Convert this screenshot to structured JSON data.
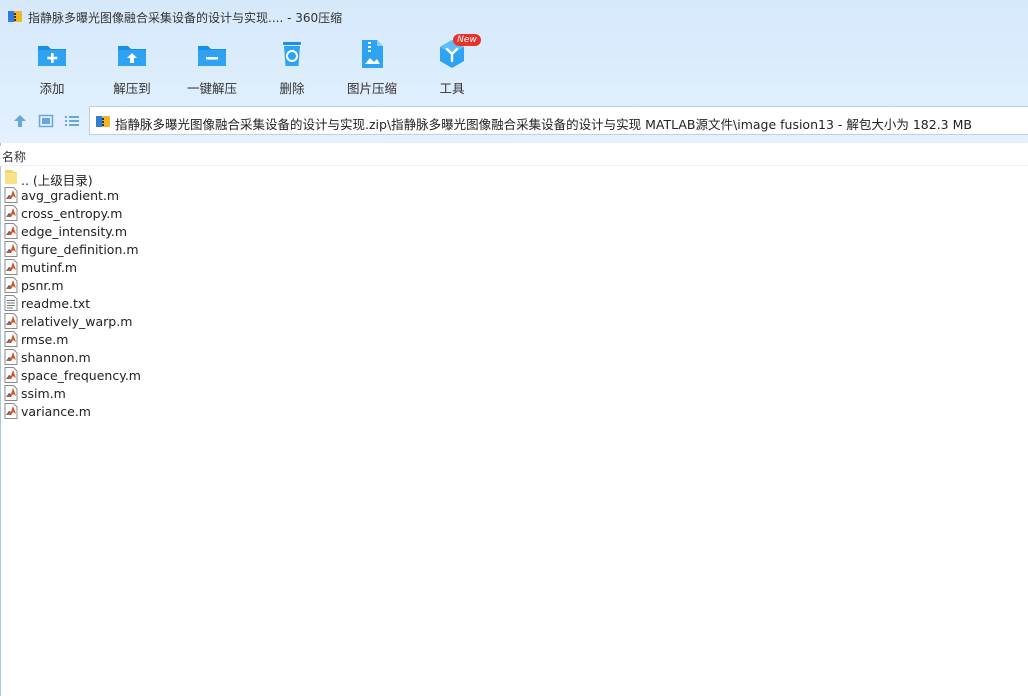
{
  "window": {
    "title": "指静脉多曝光图像融合采集设备的设计与实现.... - 360压缩"
  },
  "toolbar": {
    "buttons": [
      {
        "label": "添加",
        "icon": "add-icon"
      },
      {
        "label": "解压到",
        "icon": "extract-to-icon"
      },
      {
        "label": "一键解压",
        "icon": "one-click-extract-icon"
      },
      {
        "label": "删除",
        "icon": "delete-icon"
      },
      {
        "label": "图片压缩",
        "icon": "image-compress-icon"
      },
      {
        "label": "工具",
        "icon": "tools-icon"
      }
    ],
    "new_badge": "New"
  },
  "navigation": {
    "path": "指静脉多曝光图像融合采集设备的设计与实现.zip\\指静脉多曝光图像融合采集设备的设计与实现 MATLAB源文件\\image fusion13 - 解包大小为 182.3 MB"
  },
  "list": {
    "column_name": "名称",
    "parent_label": ".. (上级目录)",
    "files": [
      {
        "name": "avg_gradient.m",
        "type": "matlab"
      },
      {
        "name": "cross_entropy.m",
        "type": "matlab"
      },
      {
        "name": "edge_intensity.m",
        "type": "matlab"
      },
      {
        "name": "figure_definition.m",
        "type": "matlab"
      },
      {
        "name": "mutinf.m",
        "type": "matlab"
      },
      {
        "name": "psnr.m",
        "type": "matlab"
      },
      {
        "name": "readme.txt",
        "type": "text"
      },
      {
        "name": "relatively_warp.m",
        "type": "matlab"
      },
      {
        "name": "rmse.m",
        "type": "matlab"
      },
      {
        "name": "shannon.m",
        "type": "matlab"
      },
      {
        "name": "space_frequency.m",
        "type": "matlab"
      },
      {
        "name": "ssim.m",
        "type": "matlab"
      },
      {
        "name": "variance.m",
        "type": "matlab"
      }
    ]
  },
  "colors": {
    "accent": "#1a8fe8",
    "header_bg": "#d6e9fb",
    "badge": "#e8332d"
  }
}
